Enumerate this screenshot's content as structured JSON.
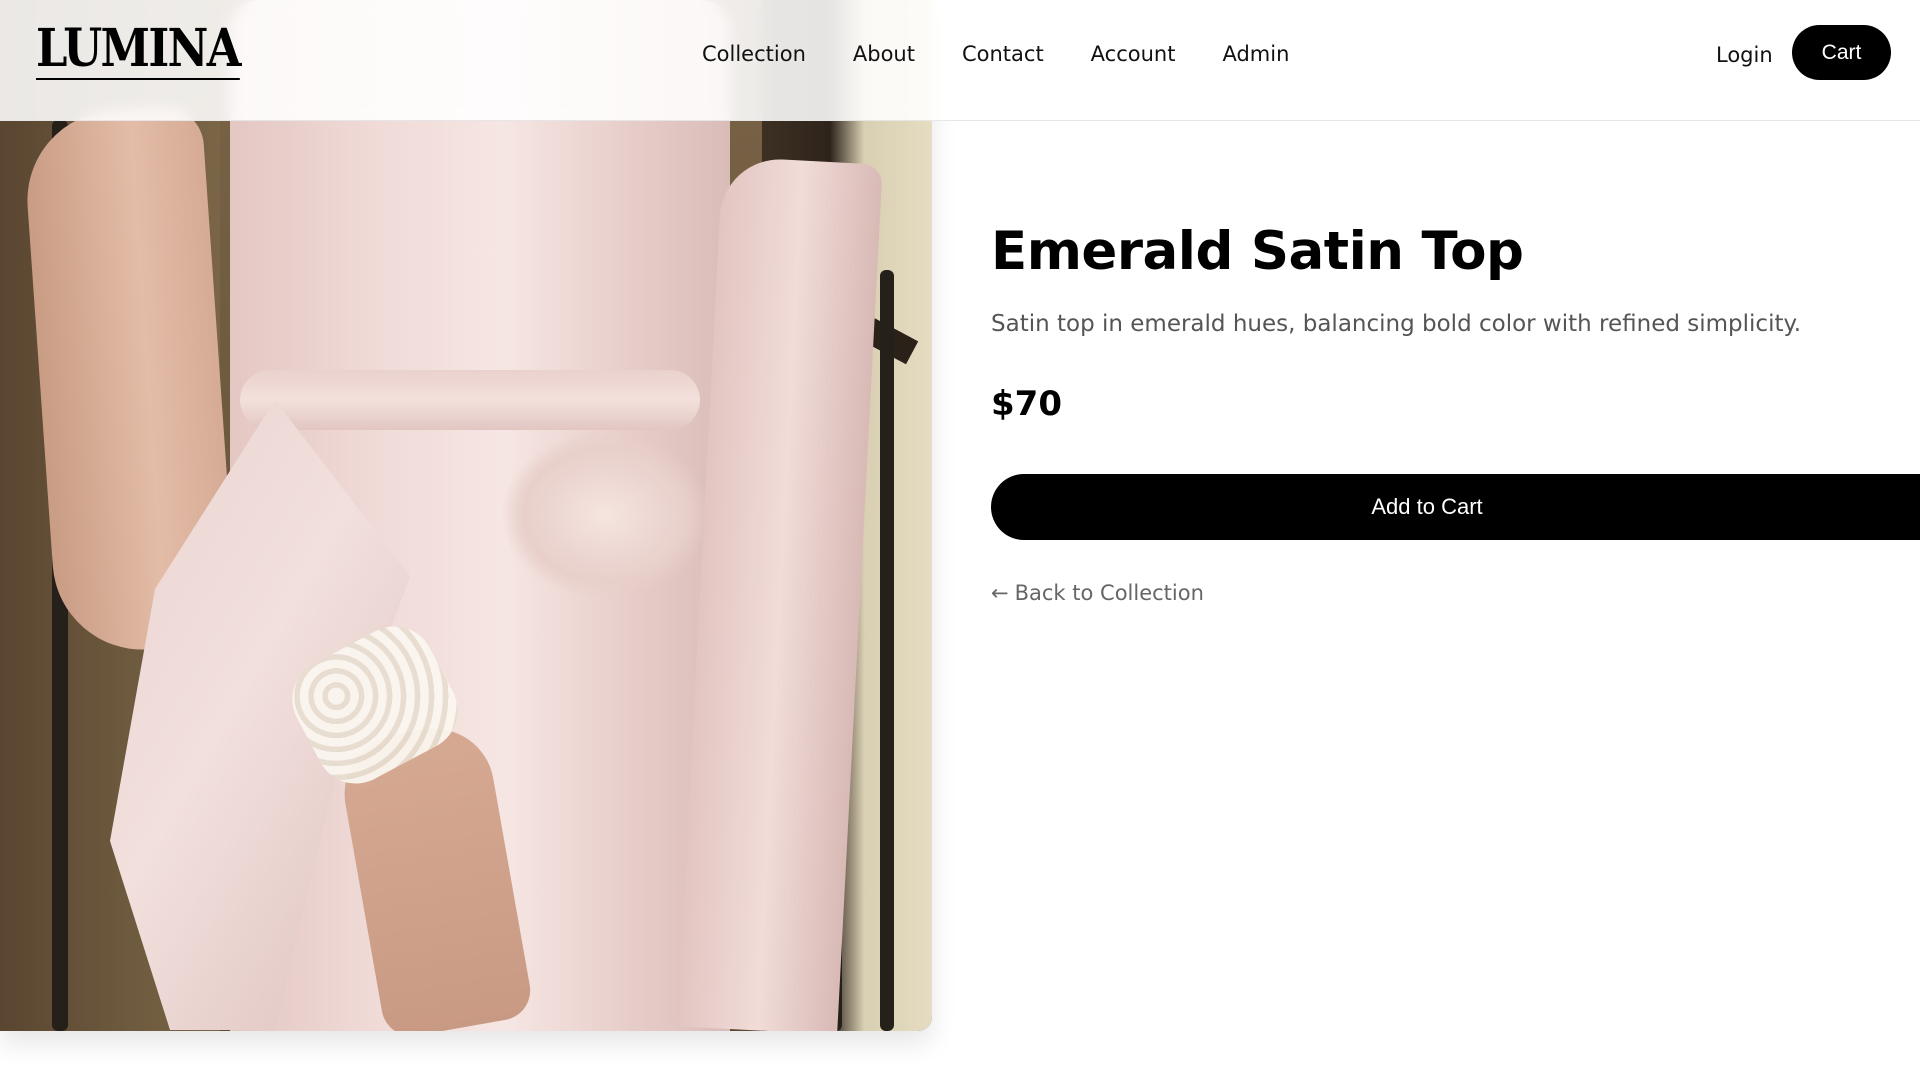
{
  "brand": {
    "logo_text": "LUMINA"
  },
  "nav": {
    "items": [
      {
        "label": "Collection"
      },
      {
        "label": "About"
      },
      {
        "label": "Contact"
      },
      {
        "label": "Account"
      },
      {
        "label": "Admin"
      }
    ],
    "login_label": "Login",
    "cart_label": "Cart"
  },
  "product": {
    "image_icon": "product-photo",
    "title": "Emerald Satin Top",
    "description": "Satin top in emerald hues, balancing bold color with refined simplicity.",
    "price": "$70",
    "add_to_cart_label": "Add to Cart",
    "back_arrow": "←",
    "back_label": "Back to Collection"
  },
  "colors": {
    "primary_button": "#000000",
    "primary_button_text": "#ffffff",
    "muted_text": "#555555",
    "background": "#ffffff"
  }
}
